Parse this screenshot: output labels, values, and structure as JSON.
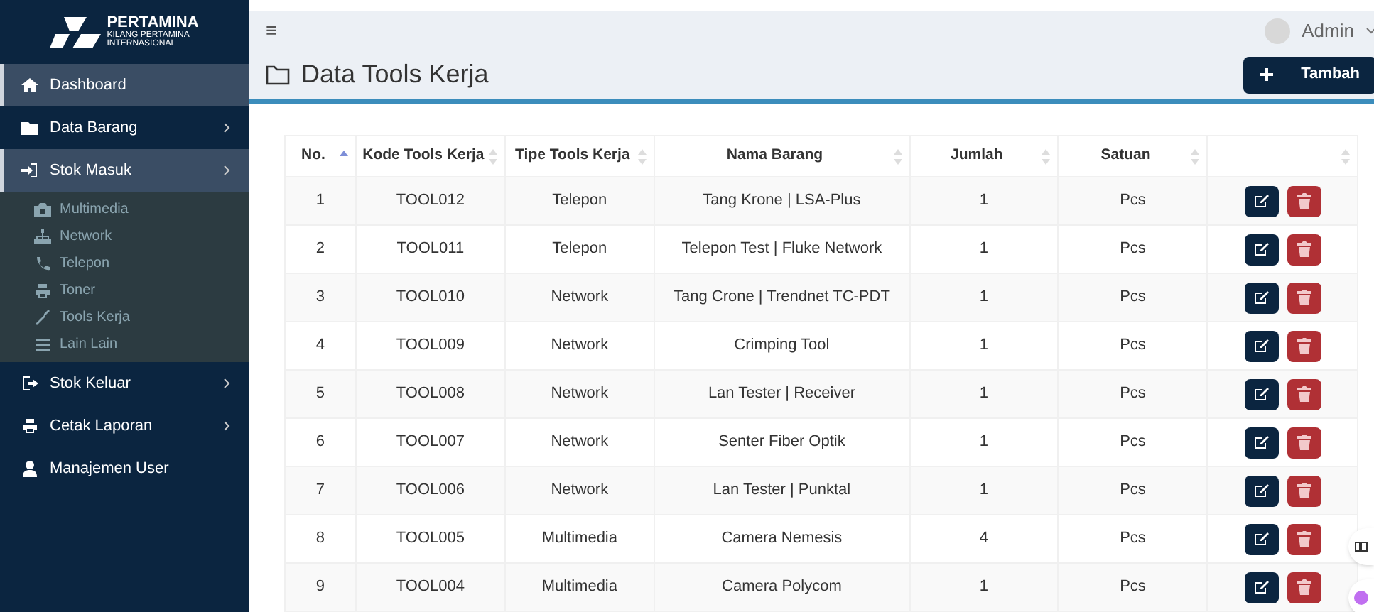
{
  "brand": {
    "name": "PERTAMINA",
    "subtitle_1": "KILANG PERTAMINA",
    "subtitle_2": "INTERNASIONAL"
  },
  "sidebar": {
    "items": [
      {
        "kind": "link",
        "label": "Dashboard",
        "selected": true,
        "has_arrow": false
      },
      {
        "kind": "link",
        "label": "Data Barang",
        "selected": false,
        "has_arrow": true
      },
      {
        "kind": "link",
        "label": "Stok Masuk",
        "selected": true,
        "has_arrow": true,
        "expanded": true,
        "children": [
          {
            "label": "Multimedia"
          },
          {
            "label": "Network"
          },
          {
            "label": "Telepon"
          },
          {
            "label": "Toner"
          },
          {
            "label": "Tools Kerja"
          },
          {
            "label": "Lain Lain"
          }
        ]
      },
      {
        "kind": "link",
        "label": "Stok Keluar",
        "selected": false,
        "has_arrow": true
      },
      {
        "kind": "link",
        "label": "Cetak Laporan",
        "selected": false,
        "has_arrow": true
      },
      {
        "kind": "link",
        "label": "Manajemen User",
        "selected": false,
        "has_arrow": false
      }
    ]
  },
  "topbar": {
    "menu_icon": "≡",
    "user": "Admin"
  },
  "page": {
    "title": "Data Tools Kerja",
    "add_button": "Tambah"
  },
  "table": {
    "columns": [
      {
        "label": "No.",
        "sorted": true
      },
      {
        "label": "Kode Tools Kerja",
        "sorted": false
      },
      {
        "label": "Tipe Tools Kerja",
        "sorted": false
      },
      {
        "label": "Nama Barang",
        "sorted": false
      },
      {
        "label": "Jumlah",
        "sorted": false
      },
      {
        "label": "Satuan",
        "sorted": false
      },
      {
        "sorted": false
      }
    ],
    "rows": [
      [
        "1",
        "TOOL012",
        "Telepon",
        "Tang Krone | LSA-Plus",
        "1",
        "Pcs"
      ],
      [
        "2",
        "TOOL011",
        "Telepon",
        "Telepon Test | Fluke Network",
        "1",
        "Pcs"
      ],
      [
        "3",
        "TOOL010",
        "Network",
        "Tang Crone | Trendnet TC-PDT",
        "1",
        "Pcs"
      ],
      [
        "4",
        "TOOL009",
        "Network",
        "Crimping Tool",
        "1",
        "Pcs"
      ],
      [
        "5",
        "TOOL008",
        "Network",
        "Lan Tester | Receiver",
        "1",
        "Pcs"
      ],
      [
        "6",
        "TOOL007",
        "Network",
        "Senter Fiber Optik",
        "1",
        "Pcs"
      ],
      [
        "7",
        "TOOL006",
        "Network",
        "Lan Tester | Punktal",
        "1",
        "Pcs"
      ],
      [
        "8",
        "TOOL005",
        "Multimedia",
        "Camera Nemesis",
        "4",
        "Pcs"
      ],
      [
        "9",
        "TOOL004",
        "Multimedia",
        "Camera Polycom",
        "1",
        "Pcs"
      ]
    ]
  }
}
